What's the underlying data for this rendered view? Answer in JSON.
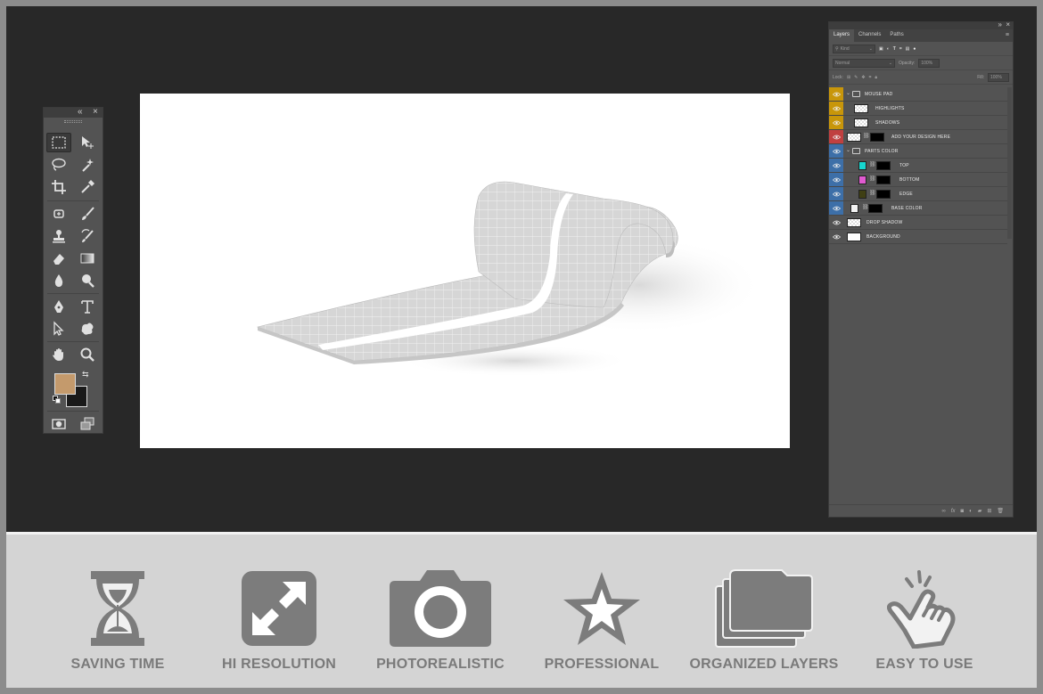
{
  "toolbox": {
    "collapse_icon": "double-chevron-left-icon",
    "close_icon": "close-icon",
    "foreground_color": "#c49a6c",
    "background_color": "#1a1a1a",
    "tools": [
      "rectangular-marquee-tool-icon",
      "move-tool-icon",
      "lasso-tool-icon",
      "magic-wand-tool-icon",
      "crop-tool-icon",
      "eyedropper-tool-icon",
      "spot-healing-brush-icon",
      "brush-tool-icon",
      "clone-stamp-tool-icon",
      "history-brush-icon",
      "eraser-tool-icon",
      "gradient-tool-icon",
      "blur-tool-icon",
      "dodge-tool-icon",
      "pen-tool-icon",
      "type-tool-icon",
      "path-selection-tool-icon",
      "custom-shape-tool-icon",
      "hand-tool-icon",
      "zoom-tool-icon",
      "quick-mask-icon",
      "screen-mode-icon"
    ]
  },
  "layers_panel": {
    "tabs": [
      "Layers",
      "Channels",
      "Paths"
    ],
    "filter_kind": "Kind",
    "blend_mode": "Normal",
    "opacity_label": "Opacity:",
    "opacity_value": "100%",
    "lock_label": "Lock:",
    "fill_label": "Fill:",
    "fill_value": "100%",
    "layers": [
      {
        "name": "MOUSE PAD",
        "color": "#c8960a",
        "type": "group"
      },
      {
        "name": "HIGHLIGHTS",
        "color": "#c8960a",
        "type": "layer"
      },
      {
        "name": "SHADOWS",
        "color": "#c8960a",
        "type": "layer"
      },
      {
        "name": "ADD YOUR DESIGN HERE",
        "color": "#c04040",
        "type": "smart"
      },
      {
        "name": "PARTS COLOR",
        "color": "#3d6fa8",
        "type": "group"
      },
      {
        "name": "TOP",
        "color": "#3d6fa8",
        "type": "fill",
        "swatch": "#17d6cf"
      },
      {
        "name": "BOTTOM",
        "color": "#3d6fa8",
        "type": "fill",
        "swatch": "#e05ad0"
      },
      {
        "name": "EDGE",
        "color": "#3d6fa8",
        "type": "fill",
        "swatch": "#3f3f14"
      },
      {
        "name": "BASE COLOR",
        "color": "#3d6fa8",
        "type": "fill",
        "swatch": "#f2f2f2"
      },
      {
        "name": "DROP SHADOW",
        "color": "",
        "type": "layer"
      },
      {
        "name": "BACKGROUND",
        "color": "",
        "type": "layer"
      }
    ]
  },
  "features": [
    {
      "label": "SAVING TIME",
      "icon": "hourglass-icon"
    },
    {
      "label": "HI RESOLUTION",
      "icon": "expand-arrows-icon"
    },
    {
      "label": "PHOTOREALISTIC",
      "icon": "camera-icon"
    },
    {
      "label": "PROFESSIONAL",
      "icon": "star-icon"
    },
    {
      "label": "ORGANIZED LAYERS",
      "icon": "stacked-folders-icon"
    },
    {
      "label": "EASY TO USE",
      "icon": "tap-hand-icon"
    }
  ]
}
